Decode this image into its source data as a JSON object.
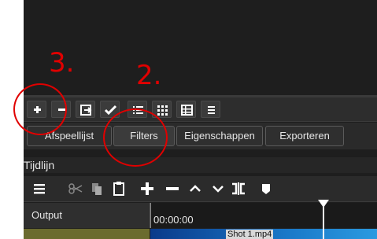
{
  "playlist_toolbar": {
    "icons": [
      "add-icon",
      "remove-icon",
      "export-icon",
      "check-icon",
      "list-view-icon",
      "grid-view-icon",
      "details-view-icon",
      "menu-icon"
    ]
  },
  "tabs": [
    {
      "label": "Afspeellijst"
    },
    {
      "label": "Filters"
    },
    {
      "label": "Eigenschappen"
    },
    {
      "label": "Exporteren"
    }
  ],
  "timeline": {
    "panel_title": "Tijdlijn",
    "toolbar_icons": [
      "menu-icon",
      "cut-icon",
      "copy-icon",
      "paste-icon",
      "append-icon",
      "remove-icon",
      "lift-icon",
      "overwrite-icon",
      "split-icon",
      "marker-icon"
    ],
    "track_name": "Output",
    "time": "00:00:00",
    "clip_name": "Shot 1.mp4"
  },
  "annotations": [
    {
      "label": "3."
    },
    {
      "label": "2."
    }
  ],
  "colors": {
    "annotation": "#e00000",
    "background": "#1e1e1e",
    "clip": "#1a78c8"
  }
}
